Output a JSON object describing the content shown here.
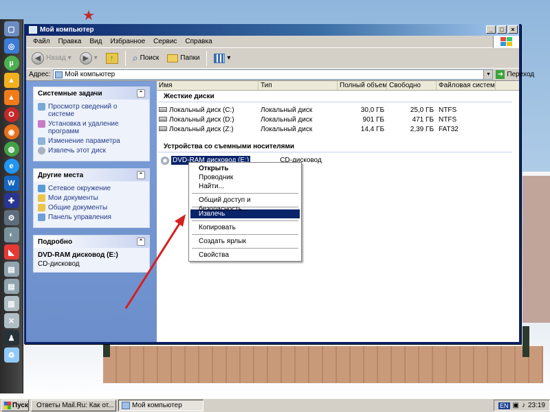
{
  "window": {
    "title": "Мой компьютер",
    "controls": [
      "_",
      "□",
      "×"
    ]
  },
  "menu": [
    "Файл",
    "Правка",
    "Вид",
    "Избранное",
    "Сервис",
    "Справка"
  ],
  "toolbar": {
    "back_label": "Назад",
    "search_label": "Поиск",
    "folders_label": "Папки"
  },
  "address": {
    "label": "Адрес:",
    "value": "Мой компьютер",
    "go_label": "Переход"
  },
  "tasks": {
    "system": {
      "title": "Системные задачи",
      "items": [
        "Просмотр сведений о системе",
        "Установка и удаление программ",
        "Изменение параметра",
        "Извлечь этот диск"
      ]
    },
    "other": {
      "title": "Другие места",
      "items": [
        "Сетевое окружение",
        "Мои документы",
        "Общие документы",
        "Панель управления"
      ]
    },
    "details": {
      "title": "Подробно",
      "name": "DVD-RAM дисковод (E:)",
      "type": "CD-дисковод"
    }
  },
  "columns": [
    "Имя",
    "Тип",
    "Полный объем",
    "Свободно",
    "Файловая система"
  ],
  "groups": {
    "hdd_title": "Жесткие диски",
    "removable_title": "Устройства со съемными носителями"
  },
  "drives": [
    {
      "name": "Локальный диск (C:)",
      "type": "Локальный диск",
      "total": "30,0 ГБ",
      "free": "25,0 ГБ",
      "fs": "NTFS"
    },
    {
      "name": "Локальный диск (D:)",
      "type": "Локальный диск",
      "total": "901 ГБ",
      "free": "471 ГБ",
      "fs": "NTFS"
    },
    {
      "name": "Локальный диск (Z:)",
      "type": "Локальный диск",
      "total": "14,4 ГБ",
      "free": "2,39 ГБ",
      "fs": "FAT32"
    }
  ],
  "dvd": {
    "name": "DVD-RAM дисковод (E:)",
    "type": "CD-дисковод"
  },
  "context_menu": {
    "open": "Открыть",
    "explorer": "Проводник",
    "find": "Найти...",
    "sharing": "Общий доступ и безопасность...",
    "eject": "Извлечь",
    "copy": "Копировать",
    "shortcut": "Создать ярлык",
    "properties": "Свойства"
  },
  "taskbar": {
    "start": "Пуск",
    "task1": "Ответы Mail.Ru: Как от...",
    "task2": "Мой компьютер",
    "lang": "EN",
    "time": "23:19"
  }
}
